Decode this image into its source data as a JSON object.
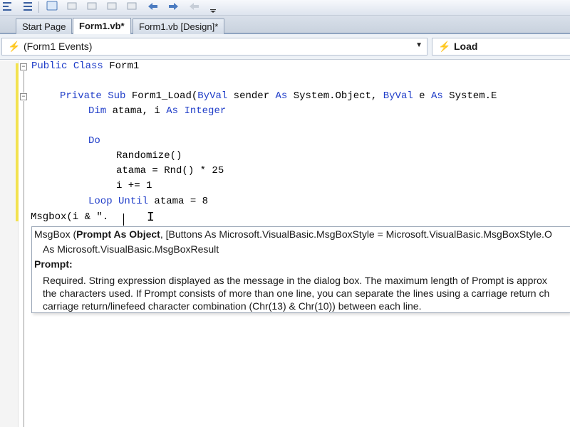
{
  "toolbar": {
    "buttons": [
      "align-left-icon",
      "format-icon",
      "comment-icon",
      "uncomment-icon",
      "bookmark-icon",
      "prev-bookmark-icon",
      "next-bookmark-icon",
      "clear-bookmark-icon",
      "overflow-icon"
    ]
  },
  "tabs": [
    {
      "label": "Start Page",
      "active": false
    },
    {
      "label": "Form1.vb*",
      "active": true
    },
    {
      "label": "Form1.vb [Design]*",
      "active": false
    }
  ],
  "nav": {
    "object_combo": "(Form1 Events)",
    "method_combo": "Load"
  },
  "code": {
    "line1": {
      "kw1": "Public",
      "kw2": "Class",
      "rest": " Form1"
    },
    "line2": {
      "kw1": "Private",
      "kw2": "Sub",
      "mid": " Form1_Load(",
      "kw3": "ByVal",
      "mid2": " sender ",
      "kw4": "As",
      "mid3": " System.Object, ",
      "kw5": "ByVal",
      "mid4": " e ",
      "kw6": "As",
      "mid5": " System.E"
    },
    "line3": {
      "kw1": "Dim",
      "mid": " atama, i ",
      "kw2": "As",
      "kw3": " Integer"
    },
    "line4": {
      "kw1": "Do"
    },
    "line5": "Randomize()",
    "line6": "atama = Rnd() * 25",
    "line7": "i += 1",
    "line8": {
      "kw1": "Loop",
      "kw2": " Until",
      "rest": " atama = 8"
    },
    "line9": "Msgbox(i & \"."
  },
  "tooltip": {
    "sig_prefix": "MsgBox (",
    "sig_param": "Prompt As Object",
    "sig_rest": ", [Buttons As Microsoft.VisualBasic.MsgBoxStyle = Microsoft.VisualBasic.MsgBoxStyle.O",
    "sig_return": "As Microsoft.VisualBasic.MsgBoxResult",
    "param_title": "Prompt:",
    "desc1": "Required. String expression displayed as the message in the dialog box. The maximum length of Prompt is approx",
    "desc2": "the characters used. If Prompt consists of more than one line, you can separate the lines using a carriage return ch",
    "desc3": "carriage return/linefeed character combination (Chr(13) & Chr(10)) between each line."
  },
  "colors": {
    "keyword": "#1e3cc8",
    "change_bar": "#f2e24f"
  }
}
